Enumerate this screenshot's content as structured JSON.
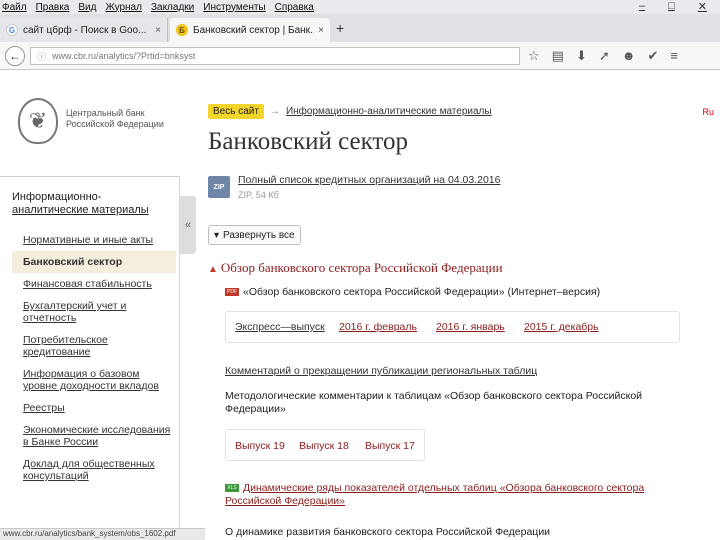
{
  "browser": {
    "menu": [
      "Файл",
      "Правка",
      "Вид",
      "Журнал",
      "Закладки",
      "Инструменты",
      "Справка"
    ],
    "window_controls": [
      "–",
      "□",
      "✕"
    ],
    "tabs": [
      {
        "title": "сайт цбрф - Поиск в Goo...",
        "favicon": "G",
        "close": "×"
      },
      {
        "title": "Банковский сектор | Банк...",
        "favicon": "Б",
        "close": "×"
      }
    ],
    "new_tab": "+",
    "url": "www.cbr.ru/analytics/?Prtid=bnksyst",
    "toolbar_icons": [
      "☆",
      "▤",
      "⬇",
      "➚",
      "☻",
      "✔",
      "≡"
    ]
  },
  "header": {
    "logo_line1": "Центральный банк",
    "logo_line2": "Российской Федерации",
    "logo_glyph": "❦",
    "breadcrumb_home": "Весь сайт",
    "breadcrumb_arrow": "→",
    "breadcrumb_link": "Информационно-аналитические материалы",
    "edge_text": "Ru",
    "page_title": "Банковский сектор"
  },
  "sidebar": {
    "heading_line1": "Информационно-",
    "heading_line2": "аналитические материалы",
    "items": [
      {
        "label": "Нормативные и иные акты"
      },
      {
        "label": "Банковский сектор"
      },
      {
        "label": "Финансовая стабильность"
      },
      {
        "label": "Бухгалтерский учет и отчетность"
      },
      {
        "label": "Потребительское кредитование"
      },
      {
        "label": "Информация о базовом уровне доходности вкладов"
      },
      {
        "label": "Реестры"
      },
      {
        "label": "Экономические исследования в Банке России"
      },
      {
        "label": "Доклад для общественных консультаций"
      }
    ],
    "collapse_glyph": "«"
  },
  "main": {
    "zip_icon_text": "ZIP",
    "zip_link": "Полный список кредитных организаций на 04.03.2016",
    "zip_size": "ZIP, 54 Кб",
    "expand_label": "Развернуть все",
    "expand_glyph": "▾",
    "section_caret": "▲",
    "section_title": "Обзор банковского сектора Российской Федерации",
    "inet_icon": "PDF",
    "inet_text": "«Обзор банковского сектора Российской Федерации» (Интернет–версия)",
    "express_links": [
      "Экспресс—выпуск",
      "2016 г. февраль",
      "2016 г. январь",
      "2015 г. декабрь"
    ],
    "comment_link": "Комментарий о прекращении публикации региональных таблиц",
    "method_text": "Методологические комментарии к таблицам «Обзор банковского сектора Российской Федерации»",
    "issues": [
      "Выпуск 19",
      "Выпуск 18",
      "Выпуск 17"
    ],
    "dyn_icon": "XLS",
    "dyn_link": "Динамические ряды показателей отдельных таблиц «Обзора банковского сектора Российской Федерации»",
    "bottom_text": "О динамике развития банковского сектора Российской Федерации"
  },
  "status": {
    "url": "www.cbr.ru/analytics/bank_system/obs_1602.pdf"
  }
}
